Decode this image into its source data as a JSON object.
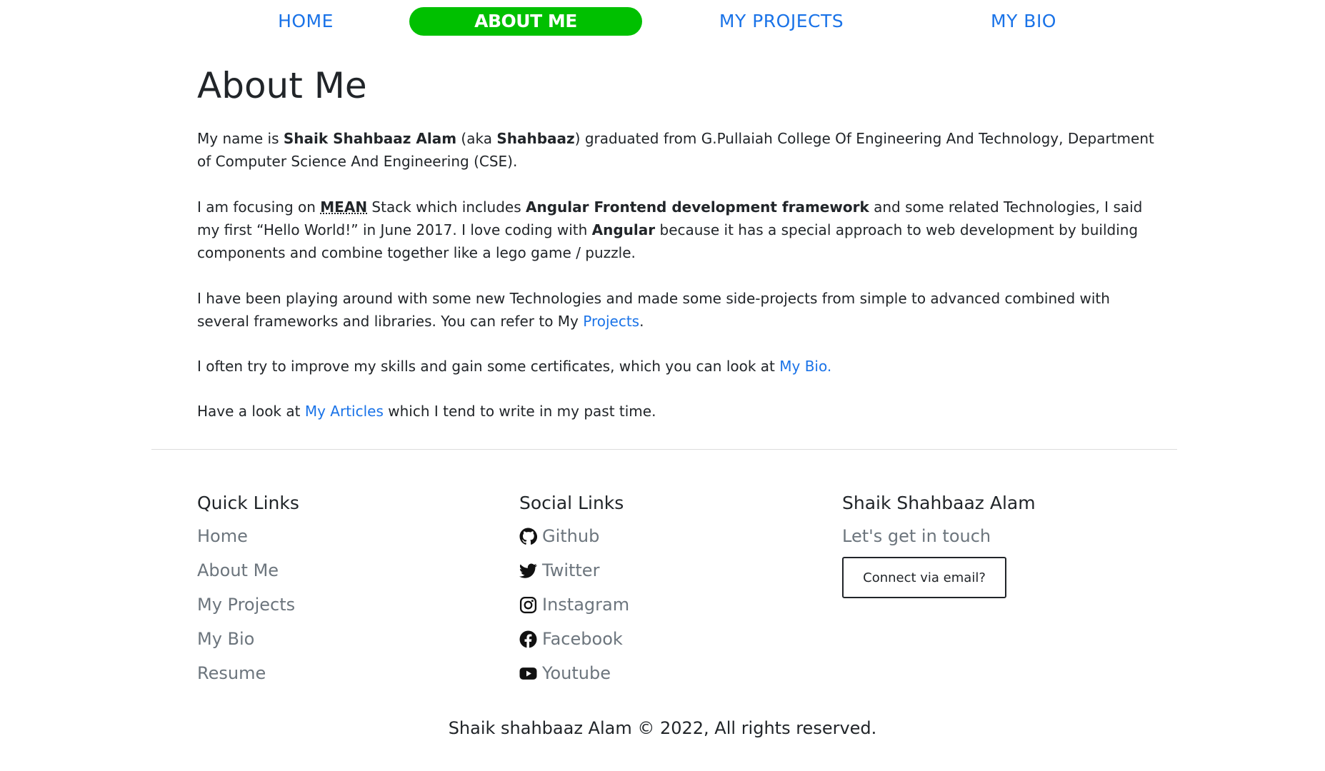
{
  "nav": {
    "items": [
      {
        "label": "HOME",
        "active": false
      },
      {
        "label": "ABOUT ME",
        "active": true
      },
      {
        "label": "MY PROJECTS",
        "active": false
      },
      {
        "label": "MY BIO",
        "active": false
      }
    ],
    "active_color": "#00c000",
    "link_color": "#1a73e8"
  },
  "main": {
    "title": "About Me",
    "p1": {
      "t1": "My name is ",
      "name": "Shaik Shahbaaz Alam",
      "t2": " (aka ",
      "nick": "Shahbaaz",
      "t3": ") graduated from G.Pullaiah College Of Engineering And Technology, Department of Computer Science And Engineering (CSE)."
    },
    "p2": {
      "t1": "I am focusing on ",
      "abbr": "MEAN",
      "t2": " Stack which includes ",
      "bold1": "Angular Frontend development framework",
      "t3": " and some related Technologies, I said my first “Hello World!” in June 2017. I love coding with ",
      "bold2": "Angular",
      "t4": " because it has a special approach to web development by building components and combine together like a lego game / puzzle."
    },
    "p3": {
      "t1": "I have been playing around with some new Technologies and made some side-projects from simple to advanced combined with several frameworks and libraries. You can refer to My ",
      "link": "Projects",
      "t2": "."
    },
    "p4": {
      "t1": "I often try to improve my skills and gain some certificates, which you can look at ",
      "link": "My Bio."
    },
    "p5": {
      "t1": "Have a look at ",
      "link": "My Articles",
      "t2": " which I tend to write in my past time."
    }
  },
  "footer": {
    "quick": {
      "heading": "Quick Links",
      "links": [
        "Home",
        "About Me",
        "My Projects",
        "My Bio",
        "Resume"
      ]
    },
    "social": {
      "heading": "Social Links",
      "links": [
        {
          "label": "Github",
          "icon": "github-icon"
        },
        {
          "label": "Twitter",
          "icon": "twitter-icon"
        },
        {
          "label": "Instagram",
          "icon": "instagram-icon"
        },
        {
          "label": "Facebook",
          "icon": "facebook-icon"
        },
        {
          "label": "Youtube",
          "icon": "youtube-icon"
        }
      ]
    },
    "contact": {
      "heading": "Shaik Shahbaaz Alam",
      "subtext": "Let's get in touch",
      "button": "Connect via email?"
    },
    "copyright": "Shaik shahbaaz Alam © 2022, All rights reserved."
  }
}
